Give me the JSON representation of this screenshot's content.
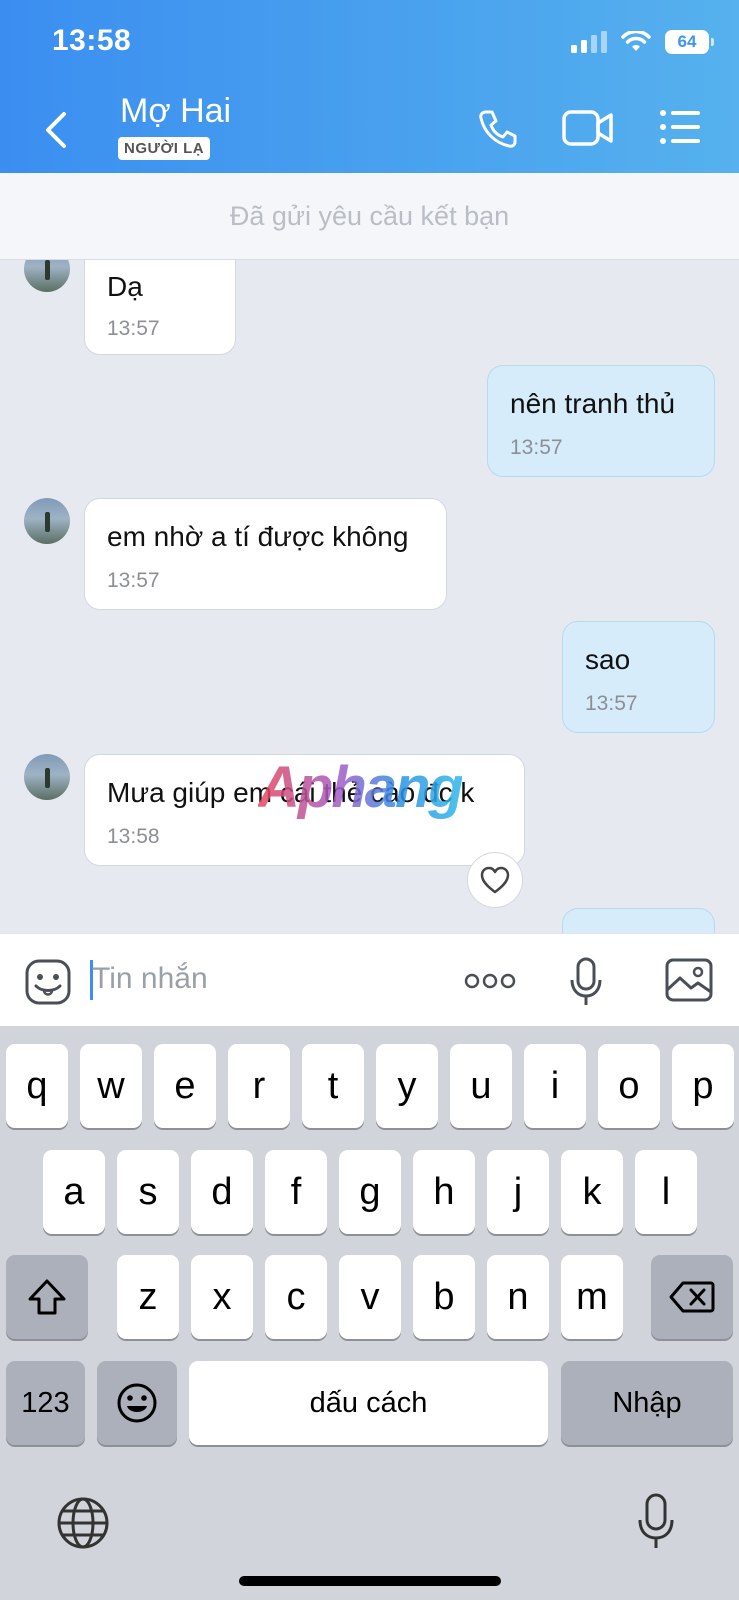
{
  "status_bar": {
    "time": "13:58",
    "battery": "64",
    "icons": [
      "signal-icon",
      "wifi-icon",
      "battery-icon"
    ]
  },
  "header": {
    "back_icon": "chevron-left-icon",
    "contact_name": "Mợ Hai",
    "contact_badge": "NGƯỜI LẠ",
    "actions": [
      "phone-icon",
      "video-call-icon",
      "menu-list-icon"
    ]
  },
  "banner": {
    "text": "Đã gửi yêu cầu kết bạn"
  },
  "messages": [
    {
      "direction": "incoming",
      "text": "Dạ",
      "time": "13:57"
    },
    {
      "direction": "outgoing",
      "text": "nên tranh thủ",
      "time": "13:57"
    },
    {
      "direction": "incoming",
      "text": "em nhờ a tí được không",
      "time": "13:57"
    },
    {
      "direction": "outgoing",
      "text": "sao",
      "time": "13:57"
    },
    {
      "direction": "incoming",
      "text": "Mưa giúp em cái thẻ cào đc k",
      "time": "13:58"
    }
  ],
  "watermark": "Aphang",
  "composer": {
    "placeholder": "Tin nhắn",
    "icons": [
      "sticker-icon",
      "more-dots-icon",
      "microphone-icon",
      "image-icon"
    ]
  },
  "keyboard": {
    "row1": [
      "q",
      "w",
      "e",
      "r",
      "t",
      "y",
      "u",
      "i",
      "o",
      "p"
    ],
    "row2": [
      "a",
      "s",
      "d",
      "f",
      "g",
      "h",
      "j",
      "k",
      "l"
    ],
    "row3": [
      "z",
      "x",
      "c",
      "v",
      "b",
      "n",
      "m"
    ],
    "numbers_key": "123",
    "space_key": "dấu cách",
    "return_key": "Nhập",
    "icons": [
      "shift-icon",
      "backspace-icon",
      "emoji-icon",
      "globe-icon",
      "dictation-icon"
    ]
  },
  "colors": {
    "header_start": "#3b8ef0",
    "header_end": "#56b1ee",
    "outgoing_bubble": "#d6ecfb",
    "chat_bg": "#e6eaf0"
  }
}
